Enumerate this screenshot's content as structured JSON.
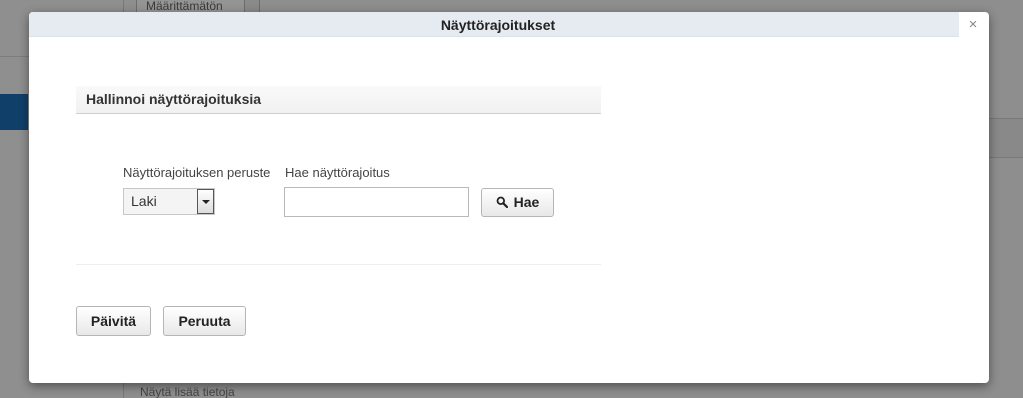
{
  "background": {
    "top_select_value": "Määrittämätön",
    "bottom_text": "Näytä lisää tietoja"
  },
  "dialog": {
    "title": "Näyttörajoitukset",
    "close_glyph": "×"
  },
  "section": {
    "title": "Hallinnoi näyttörajoituksia"
  },
  "filters": {
    "basis_label": "Näyttörajoituksen peruste",
    "basis_value": "Laki",
    "search_label": "Hae näyttörajoitus",
    "search_value": "",
    "search_button_label": "Hae",
    "search_icon": "search-icon"
  },
  "actions": {
    "update_label": "Päivitä",
    "cancel_label": "Peruuta"
  },
  "colors": {
    "titlebar_bg": "#e6ebf1",
    "accent_blue": "#1d6fb5"
  }
}
